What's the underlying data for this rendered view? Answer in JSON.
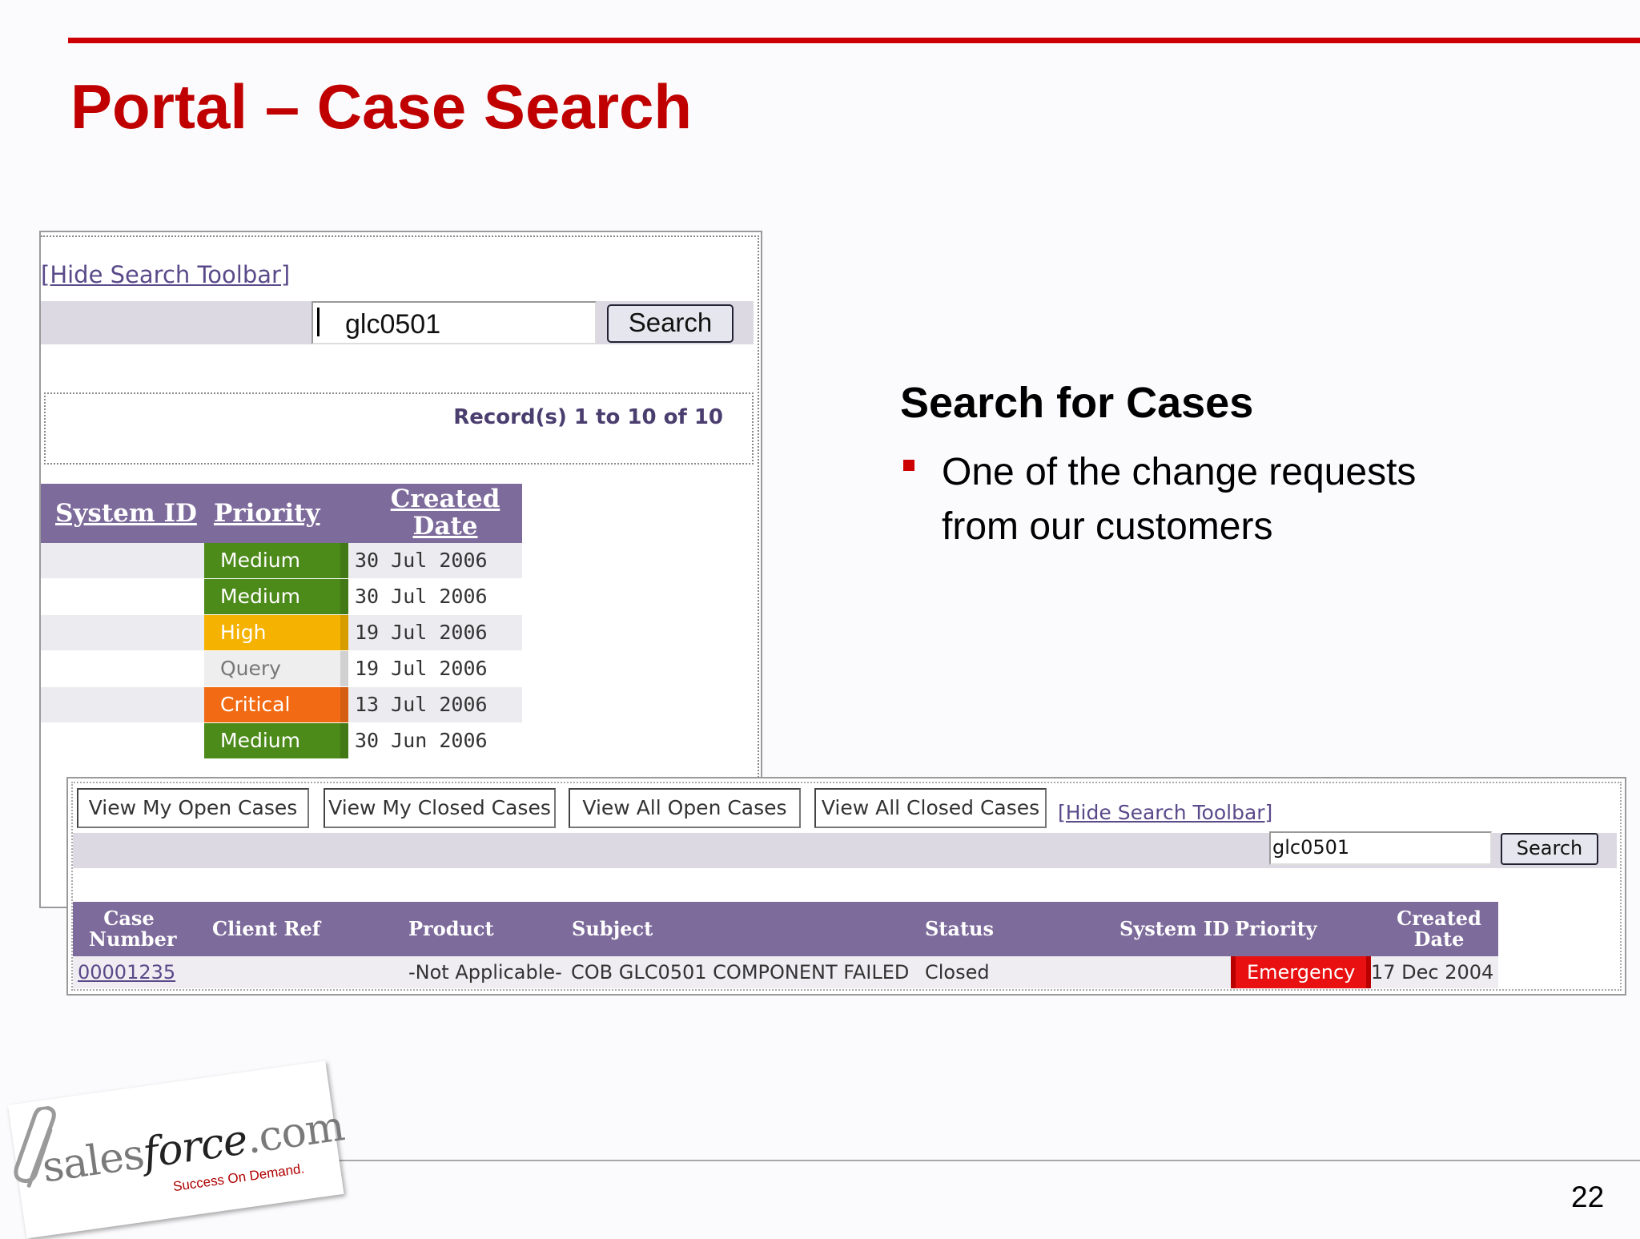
{
  "slide": {
    "title": "Portal – Case Search",
    "page_number": "22"
  },
  "shot1": {
    "hide_toolbar_link": "[Hide Search Toolbar]",
    "search_value": "glc0501",
    "search_button": "Search",
    "records_text": "Record(s) 1 to 10 of 10",
    "columns": [
      "System ID",
      "Priority",
      "Created",
      "Date"
    ],
    "rows": [
      {
        "priority": "Medium",
        "date": "30 Jul 2006",
        "level": "medium"
      },
      {
        "priority": "Medium",
        "date": "30 Jul 2006",
        "level": "medium"
      },
      {
        "priority": "High",
        "date": "19 Jul 2006",
        "level": "high"
      },
      {
        "priority": "Query",
        "date": "19 Jul 2006",
        "level": "query"
      },
      {
        "priority": "Critical",
        "date": "13 Jul 2006",
        "level": "critical"
      },
      {
        "priority": "Medium",
        "date": "30 Jun 2006",
        "level": "medium"
      }
    ]
  },
  "shot2": {
    "buttons": [
      "View My Open Cases",
      "View My Closed Cases",
      "View All Open Cases",
      "View All Closed Cases"
    ],
    "hide_toolbar_link": "[Hide Search Toolbar]",
    "search_value": "glc0501",
    "search_button": "Search",
    "columns": {
      "case_number_1": "Case",
      "case_number_2": "Number",
      "client_ref": "Client Ref",
      "product": "Product",
      "subject": "Subject",
      "status": "Status",
      "system_id": "System ID",
      "priority": "Priority",
      "created_1": "Created",
      "created_2": "Date"
    },
    "row": {
      "case_number": "00001235",
      "product": "-Not Applicable-",
      "subject": "COB GLC0501 COMPONENT FAILED",
      "status": "Closed",
      "priority": "Emergency",
      "created": "17 Dec 2004"
    }
  },
  "content": {
    "heading": "Search for Cases",
    "bullet": "One of the change requests from our customers"
  },
  "logo": {
    "wordmark_left": "sales",
    "wordmark_force": "force",
    "wordmark_right": ".com",
    "tagline": "Success On Demand."
  },
  "colors": {
    "title_red": "#c00000",
    "grid_header": "#7d6b9b",
    "priority_medium": "#4c8a1a",
    "priority_high": "#f5b200",
    "priority_critical": "#f26b14",
    "priority_emergency": "#e81010"
  }
}
